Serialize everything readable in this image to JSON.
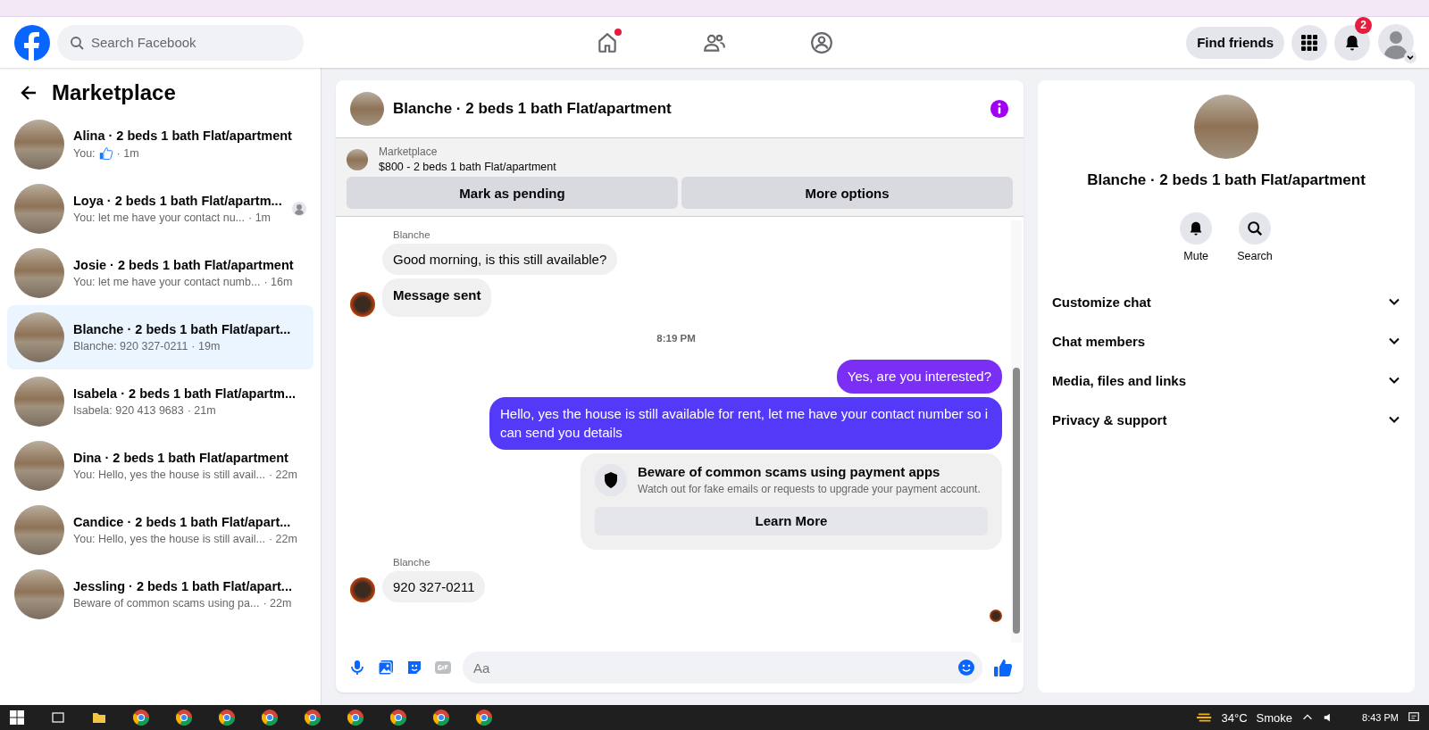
{
  "topbar": {
    "search": {
      "placeholder": "Search Facebook"
    },
    "nav": [
      {
        "kind": "home",
        "dot": true
      },
      {
        "kind": "friends",
        "dot": false
      },
      {
        "kind": "groups",
        "dot": false
      }
    ],
    "find_friends": "Find friends",
    "notifications": "2"
  },
  "sidebar": {
    "title": "Marketplace",
    "conversations": [
      {
        "name": "Alina · 2 beds 1 bath Flat/apartment",
        "preview": "You:",
        "like": true,
        "time": "· 1m",
        "seen": false,
        "selected": false
      },
      {
        "name": "Loya · 2 beds 1 bath Flat/apartm...",
        "preview": "You: let me have your contact nu...",
        "like": false,
        "time": "· 1m",
        "seen": true,
        "selected": false
      },
      {
        "name": "Josie · 2 beds 1 bath Flat/apartment",
        "preview": "You: let me have your contact numb...",
        "like": false,
        "time": "· 16m",
        "seen": false,
        "selected": false
      },
      {
        "name": "Blanche · 2 beds 1 bath Flat/apart...",
        "preview": "Blanche: 920 327-0211",
        "like": false,
        "time": "· 19m",
        "seen": false,
        "selected": true
      },
      {
        "name": "Isabela · 2 beds 1 bath Flat/apartm...",
        "preview": "Isabela: 920 413 9683",
        "like": false,
        "time": "· 21m",
        "seen": false,
        "selected": false
      },
      {
        "name": "Dina · 2 beds 1 bath Flat/apartment",
        "preview": "You: Hello, yes the house is still avail...",
        "like": false,
        "time": "· 22m",
        "seen": false,
        "selected": false
      },
      {
        "name": "Candice · 2 beds 1 bath Flat/apart...",
        "preview": "You: Hello, yes the house is still avail...",
        "like": false,
        "time": "· 22m",
        "seen": false,
        "selected": false
      },
      {
        "name": "Jessling · 2 beds 1 bath Flat/apart...",
        "preview": "Beware of common scams using pa...",
        "like": false,
        "time": "· 22m",
        "seen": false,
        "selected": false
      }
    ]
  },
  "chat": {
    "title": "Blanche · 2 beds 1 bath Flat/apartment",
    "listing": {
      "label": "Marketplace",
      "price": "$800 - 2 beds 1 bath Flat/apartment"
    },
    "buttons": [
      "Mark as pending",
      "More options"
    ],
    "messages": [
      {
        "kind": "name",
        "text": "Blanche"
      },
      {
        "kind": "in",
        "text": "Good morning, is this still available?",
        "bold": false,
        "avatar": false
      },
      {
        "kind": "in",
        "text": "Message sent",
        "bold": true,
        "avatar": true
      },
      {
        "kind": "time",
        "text": "8:19 PM"
      },
      {
        "kind": "out",
        "text": "Yes, are you interested?",
        "color": "#7b2ff5"
      },
      {
        "kind": "out",
        "text": "Hello, yes the house is still available for rent, let me have your contact number so i can send you details",
        "color": "#5339f8"
      },
      {
        "kind": "notice",
        "title": "Beware of common scams using payment apps",
        "text": "Watch out for fake emails or requests to upgrade your payment account.",
        "button": "Learn More"
      },
      {
        "kind": "name",
        "text": "Blanche"
      },
      {
        "kind": "in",
        "text": "920 327-0211",
        "bold": false,
        "avatar": true
      }
    ],
    "composer": {
      "placeholder": "Aa"
    }
  },
  "details": {
    "name": "Blanche · 2 beds 1 bath Flat/apartment",
    "actions": [
      {
        "kind": "mute",
        "label": "Mute"
      },
      {
        "kind": "search",
        "label": "Search"
      }
    ],
    "sections": [
      {
        "label": "Customize chat",
        "expanded": false
      },
      {
        "label": "Chat members",
        "expanded": false
      },
      {
        "label": "Media, files and links",
        "expanded": false
      },
      {
        "label": "Privacy & support",
        "expanded": false
      }
    ]
  },
  "taskbar": {
    "temperature": "34°C",
    "weather": "Smoke",
    "time": "8:43 PM"
  }
}
